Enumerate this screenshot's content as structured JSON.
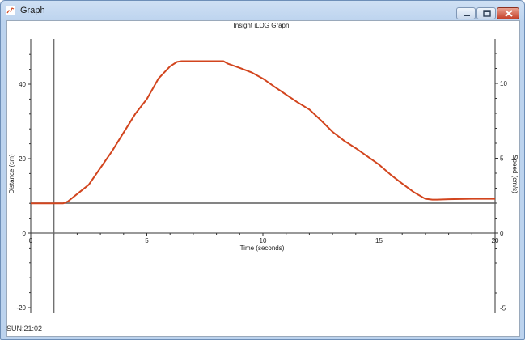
{
  "window": {
    "title": "Graph",
    "icon": "graph-app-icon",
    "controls": [
      "minimize-icon",
      "maximize-icon",
      "close-icon"
    ]
  },
  "status_bar": {
    "text": "SUN:21:02"
  },
  "chart_data": {
    "type": "line",
    "title": "Insight iLOG Graph",
    "xlabel": "Time (seconds)",
    "ylabel": "Distance (cm)",
    "y2label": "Speed (cm/s)",
    "xlim": [
      0,
      20
    ],
    "ylim": [
      -20,
      50
    ],
    "y2lim": [
      -5,
      12.5
    ],
    "xticks": [
      0,
      5,
      10,
      15,
      20
    ],
    "yticks": [
      -20,
      0,
      20,
      40
    ],
    "y2ticks": [
      -5,
      0,
      5,
      10
    ],
    "grid": false,
    "cursor_time": 1,
    "colors": {
      "distance": "#d2451e",
      "speed": "#5c5c5c",
      "cursor": "#6a6a6a"
    },
    "series": [
      {
        "axis": "left",
        "x": [
          0,
          1.4,
          1.6,
          2.0,
          2.5,
          3.0,
          3.5,
          4.0,
          4.5,
          5.0,
          5.5,
          6.0,
          6.3,
          6.5,
          7.0,
          7.5,
          8.0,
          8.3,
          8.5,
          9.0,
          9.5,
          10.0,
          10.5,
          11.0,
          11.5,
          12.0,
          12.5,
          13.0,
          13.5,
          14.0,
          14.5,
          15.0,
          15.5,
          16.0,
          16.5,
          17.0,
          17.3,
          17.5,
          18.0,
          19.0,
          20.0
        ],
        "y": [
          8,
          8,
          8.5,
          10.5,
          13,
          17.5,
          22,
          27,
          32,
          36,
          41.5,
          44.8,
          46,
          46.2,
          46.2,
          46.2,
          46.2,
          46.2,
          45.5,
          44.4,
          43.2,
          41.5,
          39.3,
          37.2,
          35.1,
          33.2,
          30.3,
          27.2,
          24.8,
          22.8,
          20.6,
          18.4,
          15.7,
          13.3,
          11,
          9.2,
          9,
          9,
          9.1,
          9.2,
          9.2
        ]
      },
      {
        "axis": "right",
        "x": [
          0,
          20
        ],
        "y": [
          2,
          2
        ]
      }
    ]
  }
}
